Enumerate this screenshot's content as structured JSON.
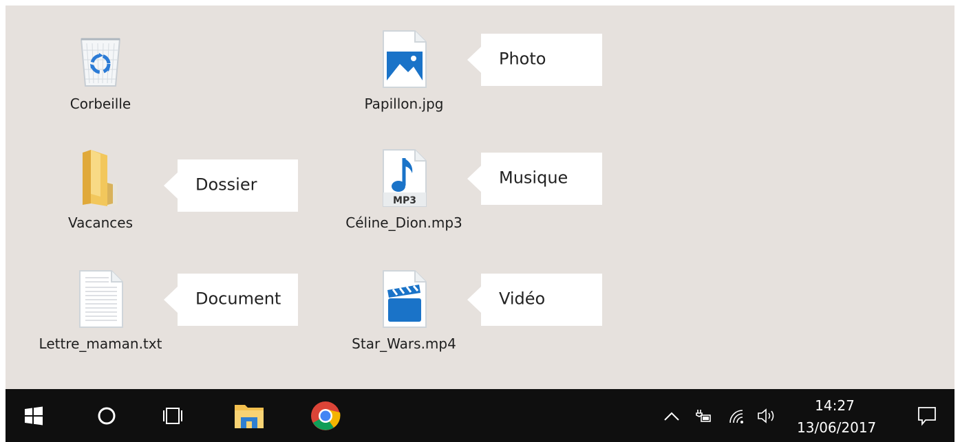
{
  "desktop": {
    "icons": [
      {
        "label": "Corbeille",
        "icon": "recycle-bin-icon"
      },
      {
        "label": "Papillon.jpg",
        "icon": "image-file-icon"
      },
      {
        "label": "Vacances",
        "icon": "folder-icon"
      },
      {
        "label": "Céline_Dion.mp3",
        "icon": "mp3-file-icon",
        "badge": "MP3"
      },
      {
        "label": "Lettre_maman.txt",
        "icon": "text-file-icon"
      },
      {
        "label": "Star_Wars.mp4",
        "icon": "video-file-icon"
      }
    ],
    "callouts": {
      "photo": "Photo",
      "dossier": "Dossier",
      "musique": "Musique",
      "document": "Document",
      "video": "Vidéo"
    }
  },
  "taskbar": {
    "items": [
      "windows-start-icon",
      "cortana-search-icon",
      "task-view-icon",
      "file-explorer-icon",
      "chrome-icon"
    ],
    "tray": [
      "chevron-up-icon",
      "battery-icon",
      "wifi-icon",
      "volume-icon"
    ],
    "time": "14:27",
    "date": "13/06/2017",
    "notification": "action-center-icon"
  },
  "colors": {
    "desktop_bg": "#e6e1dd",
    "taskbar_bg": "#0f0f0f",
    "accent_blue": "#1a73c8"
  }
}
